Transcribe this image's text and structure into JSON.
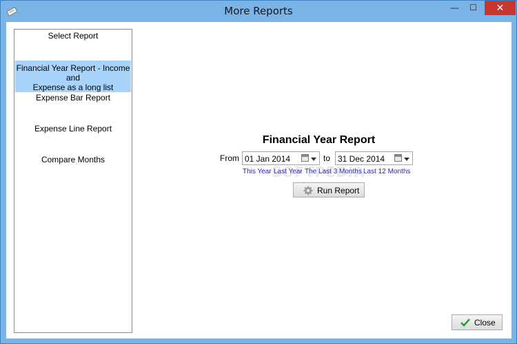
{
  "window": {
    "title": "More Reports"
  },
  "controls": {
    "minimize": "—",
    "maximize": "☐",
    "close": "✕"
  },
  "sidebar": {
    "header": "Select Report",
    "items": [
      {
        "label_line1": "Financial Year Report - Income and",
        "label_line2": "Expense as a long list",
        "selected": true
      },
      {
        "label": "Expense Bar Report"
      },
      {
        "label": "Expense Line Report"
      },
      {
        "label": "Compare Months"
      }
    ]
  },
  "main": {
    "title": "Financial Year Report",
    "from_label": "From :",
    "from_value": "01 Jan  2014",
    "to_label": "to",
    "to_value": "31 Dec 2014",
    "quick_links": [
      "This Year",
      "Last Year",
      "The Last 3 Months",
      "Last 12 Months"
    ],
    "run_button": "Run Report",
    "watermark": "SOFTPEDIA"
  },
  "footer": {
    "close_button": "Close"
  },
  "colors": {
    "titlebar": "#7ab3e6",
    "selection": "#a8d3fb",
    "link": "#1f1fcc",
    "close_button": "#c7372d"
  }
}
